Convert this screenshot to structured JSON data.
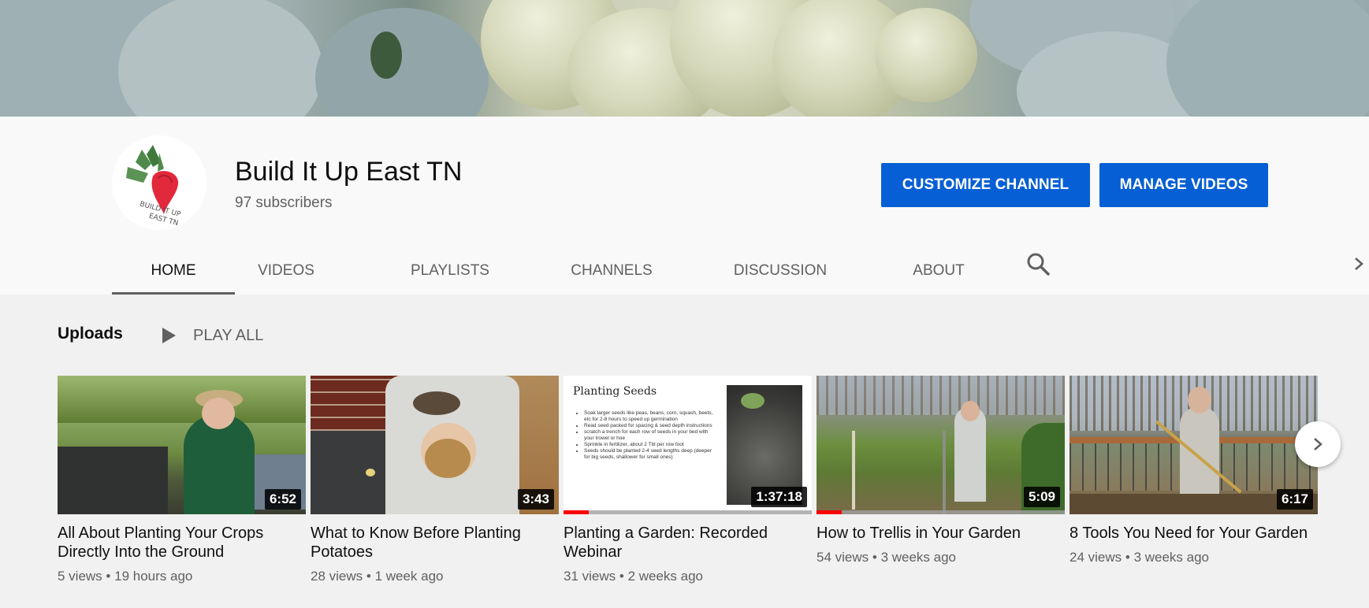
{
  "channel": {
    "name": "Build It Up East TN",
    "subscribers": "97 subscribers",
    "avatar_text": "BUILD IT UP EAST TN"
  },
  "actions": {
    "customize": "CUSTOMIZE CHANNEL",
    "manage": "MANAGE VIDEOS"
  },
  "tabs": [
    {
      "label": "HOME",
      "active": true
    },
    {
      "label": "VIDEOS"
    },
    {
      "label": "PLAYLISTS"
    },
    {
      "label": "CHANNELS"
    },
    {
      "label": "DISCUSSION"
    },
    {
      "label": "ABOUT"
    }
  ],
  "uploads": {
    "title": "Uploads",
    "play_all": "PLAY ALL"
  },
  "videos": [
    {
      "title": "All About Planting Your Crops Directly Into the Ground",
      "duration": "6:52",
      "views": "5 views",
      "age": "19 hours ago"
    },
    {
      "title": "What to Know Before Planting Potatoes",
      "duration": "3:43",
      "views": "28 views",
      "age": "1 week ago"
    },
    {
      "title": "Planting a Garden: Recorded Webinar",
      "duration": "1:37:18",
      "views": "31 views",
      "age": "2 weeks ago",
      "watched": 0.1,
      "slide": {
        "heading": "Planting Seeds",
        "bullets": [
          "Soak larger seeds like peas, beans, corn, squash, beets, etc for 2-8 hours to speed up germination",
          "Read seed packed for spacing & seed depth instructions",
          "scratch a trench for each row of seeds in your bed with your trowel or hoe",
          "Sprinkle in fertilizer, about 2 Tbl per row foot",
          "Seeds should be planted 2-4 seed lengths deep (deeper for big seeds, shallower for small ones)"
        ]
      }
    },
    {
      "title": "How to Trellis in Your Garden",
      "duration": "5:09",
      "views": "54 views",
      "age": "3 weeks ago",
      "watched": 0.1
    },
    {
      "title": "8 Tools You Need for Your Garden",
      "duration": "6:17",
      "views": "24 views",
      "age": "3 weeks ago"
    }
  ],
  "meta_separator": "•",
  "colors": {
    "accent": "#065fd4",
    "progress": "#ff0000",
    "background": "#f1f1f1",
    "header_bg": "#f9f9f9"
  },
  "icons": [
    "search-icon",
    "chevron-right-icon",
    "play-icon",
    "next-arrow-icon",
    "radish-logo-icon"
  ]
}
